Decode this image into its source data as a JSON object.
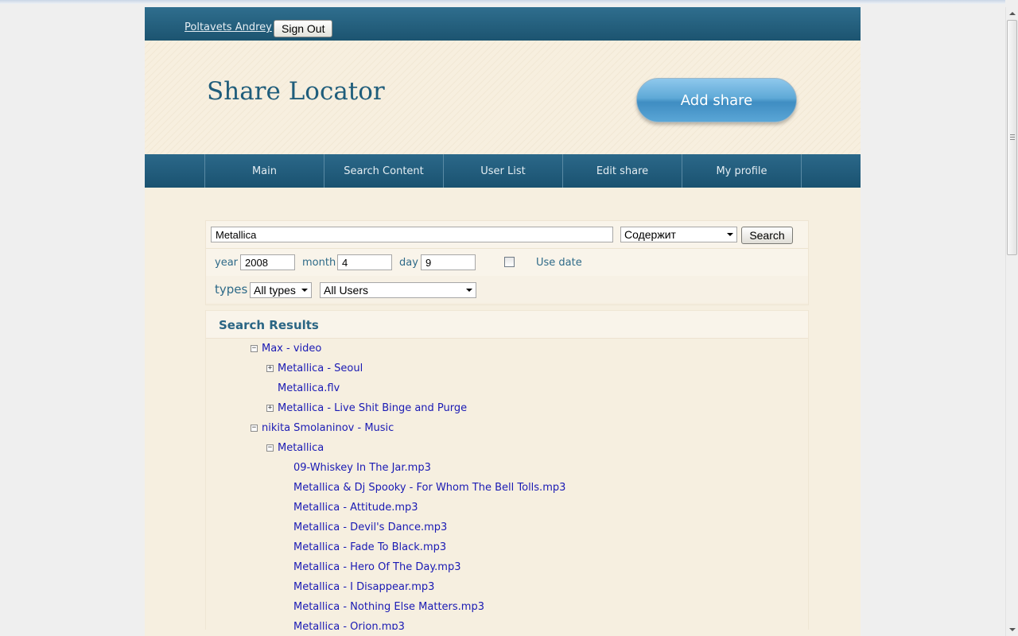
{
  "user": {
    "name": "Poltavets Andrey",
    "sign_out": "Sign Out"
  },
  "header": {
    "title": "Share Locator",
    "add_share": "Add share"
  },
  "nav": [
    "Main",
    "Search Content",
    "User List",
    "Edit share",
    "My profile"
  ],
  "search": {
    "query": "Metallica",
    "match_mode": "Содержит",
    "button": "Search",
    "year_label": "year",
    "year": "2008",
    "month_label": "month",
    "month": "4",
    "day_label": "day",
    "day": "9",
    "use_date_label": "Use date",
    "use_date_checked": false,
    "types_label": "types",
    "types_value": "All types",
    "users_value": "All Users"
  },
  "results": {
    "title": "Search Results",
    "tree": [
      {
        "label": "Max - video",
        "level": 0,
        "toggle": "minus"
      },
      {
        "label": "Metallica - Seoul",
        "level": 1,
        "toggle": "plus"
      },
      {
        "label": "Metallica.flv",
        "level": 1,
        "toggle": "none"
      },
      {
        "label": "Metallica - Live Shit Binge and Purge",
        "level": 1,
        "toggle": "plus"
      },
      {
        "label": "nikita Smolaninov - Music",
        "level": 0,
        "toggle": "minus"
      },
      {
        "label": "Metallica",
        "level": 1,
        "toggle": "minus"
      },
      {
        "label": "09-Whiskey In The Jar.mp3",
        "level": 2,
        "toggle": "none"
      },
      {
        "label": "Metallica & Dj Spooky - For Whom The Bell Tolls.mp3",
        "level": 2,
        "toggle": "none"
      },
      {
        "label": "Metallica - Attitude.mp3",
        "level": 2,
        "toggle": "none"
      },
      {
        "label": "Metallica - Devil's Dance.mp3",
        "level": 2,
        "toggle": "none"
      },
      {
        "label": "Metallica - Fade To Black.mp3",
        "level": 2,
        "toggle": "none"
      },
      {
        "label": "Metallica - Hero Of The Day.mp3",
        "level": 2,
        "toggle": "none"
      },
      {
        "label": "Metallica - I Disappear.mp3",
        "level": 2,
        "toggle": "none"
      },
      {
        "label": "Metallica - Nothing Else Matters.mp3",
        "level": 2,
        "toggle": "none"
      },
      {
        "label": "Metallica - Orion.mp3",
        "level": 2,
        "toggle": "none"
      }
    ]
  },
  "colors": {
    "nav_bg": "#1f5a78",
    "page_bg": "#f6efe0",
    "link": "#1a1ab4",
    "accent": "#2a6584"
  }
}
